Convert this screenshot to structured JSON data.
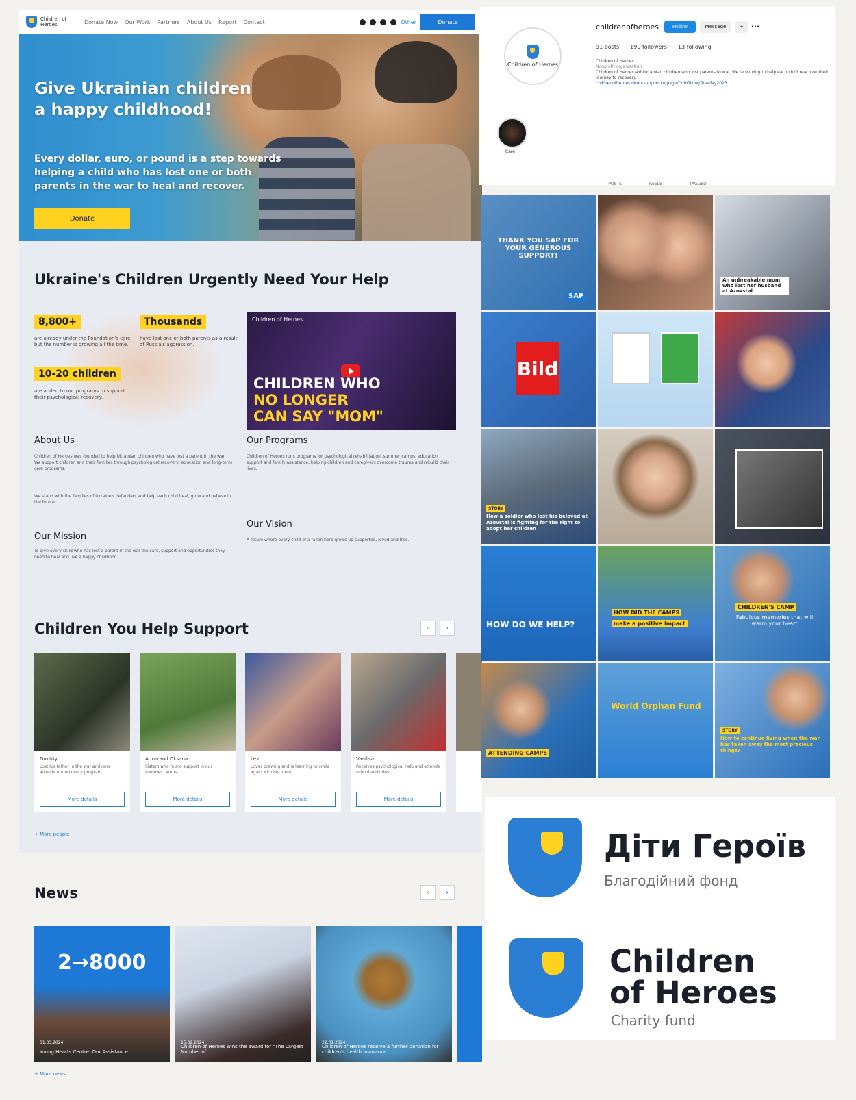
{
  "nav": {
    "logo": "Children of Heroes",
    "links": [
      "Donate Now",
      "Our Work",
      "Partners",
      "About Us",
      "Report",
      "Contact"
    ],
    "lang": "Other",
    "donate": "Donate"
  },
  "hero": {
    "title": "Give Ukrainian children a happy childhood!",
    "text": "Every dollar, euro, or pound is a step towards helping a child who has lost one or both parents in the war to heal and recover.",
    "button": "Donate"
  },
  "urgent": {
    "title": "Ukraine's Children Urgently Need Your Help",
    "stats": [
      {
        "value": "8,800+",
        "text": "are already under the Foundation's care, but the number is growing all the time."
      },
      {
        "value": "Thousands",
        "text": "have lost one or both parents as a result of Russia's aggression."
      },
      {
        "value": "10-20 children",
        "text": "are added to our programs to support their psychological recovery."
      }
    ],
    "video": {
      "channel": "Children of Heroes",
      "title_line1": "CHILDREN WHO",
      "title_line2": "NO LONGER",
      "title_line3": "CAN SAY \"MOM\""
    }
  },
  "about": {
    "title": "About Us",
    "text1": "Children of Heroes was founded to help Ukrainian children who have lost a parent in the war. We support children and their families through psychological recovery, education and long-term care programs.",
    "text2": "We stand with the families of Ukraine's defenders and help each child heal, grow and believe in the future."
  },
  "programs": {
    "title": "Our Programs",
    "text": "Children of Heroes runs programs for psychological rehabilitation, summer camps, education support and family assistance, helping children and caregivers overcome trauma and rebuild their lives."
  },
  "mission": {
    "title": "Our Mission",
    "text": "To give every child who has lost a parent in the war the care, support and opportunities they need to heal and live a happy childhood."
  },
  "vision": {
    "title": "Our Vision",
    "text": "A future where every child of a fallen hero grows up supported, loved and free."
  },
  "support": {
    "title": "Children You Help Support",
    "cards": [
      {
        "name": "Dmitriy",
        "desc": "Lost his father in the war and now attends our recovery program.",
        "button": "More details"
      },
      {
        "name": "Arina and Oksana",
        "desc": "Sisters who found support in our summer camps.",
        "button": "More details"
      },
      {
        "name": "Lev",
        "desc": "Loves drawing and is learning to smile again with his mom.",
        "button": "More details"
      },
      {
        "name": "Vasilisa",
        "desc": "Receives psychological help and attends school activities.",
        "button": "More details"
      }
    ],
    "more": "+ More people"
  },
  "news": {
    "title": "News",
    "items": [
      {
        "date": "01.03.2024",
        "title": "Young Hearts Centre: Our Assistance",
        "big": "2→8000"
      },
      {
        "date": "15.02.2024",
        "title": "Children of Heroes wins the award for \"The Largest Number of...",
        "big": ""
      },
      {
        "date": "22.01.2024",
        "title": "Children of Heroes receive a further donation for children's health insurance",
        "big": ""
      }
    ],
    "more": "+ More news"
  },
  "instagram": {
    "handle": "childrenofheroes",
    "follow": "Follow",
    "message": "Message",
    "posts": "91 posts",
    "followers": "190 followers",
    "following": "13 following",
    "bio_name": "Children of Heroes",
    "bio_cat": "Nonprofit organization",
    "bio": "Children of Heroes aid Ukrainian children who lost parents to war. We're striving to help each child reach on their journey to recovery.",
    "link": "childrenofheroes.donorsupport.co/page/CoHGivingTuesday2023",
    "highlight": "Care",
    "avatar_text": "Children of Heroes",
    "tabs": [
      "POSTS",
      "REELS",
      "TAGGED"
    ]
  },
  "grid": {
    "t1": "THANK YOU SAP FOR YOUR GENEROUS SUPPORT!",
    "t1b": "SAP",
    "t3": "An unbreakable mom who lost her husband at Azovstal",
    "t4": "Bild",
    "t7": "How a soldier who lost his beloved at Azovstal is fighting for the right to adopt her children",
    "t10": "HOW DO WE HELP?",
    "t11a": "HOW DID THE CAMPS",
    "t11b": "make a positive impact",
    "t12a": "CHILDREN'S CAMP",
    "t12b": "Fabulous memories that will warm your heart",
    "t13": "ATTENDING CAMPS",
    "t14": "World Orphan Fund",
    "t15": "How to continue living when the war has taken away the most precious things?",
    "story": "STORY"
  },
  "logos": {
    "ua_name": "Діти Героїв",
    "ua_sub": "Благодійний фонд",
    "en_name1": "Children",
    "en_name2": "of Heroes",
    "en_sub": "Charity fund"
  }
}
